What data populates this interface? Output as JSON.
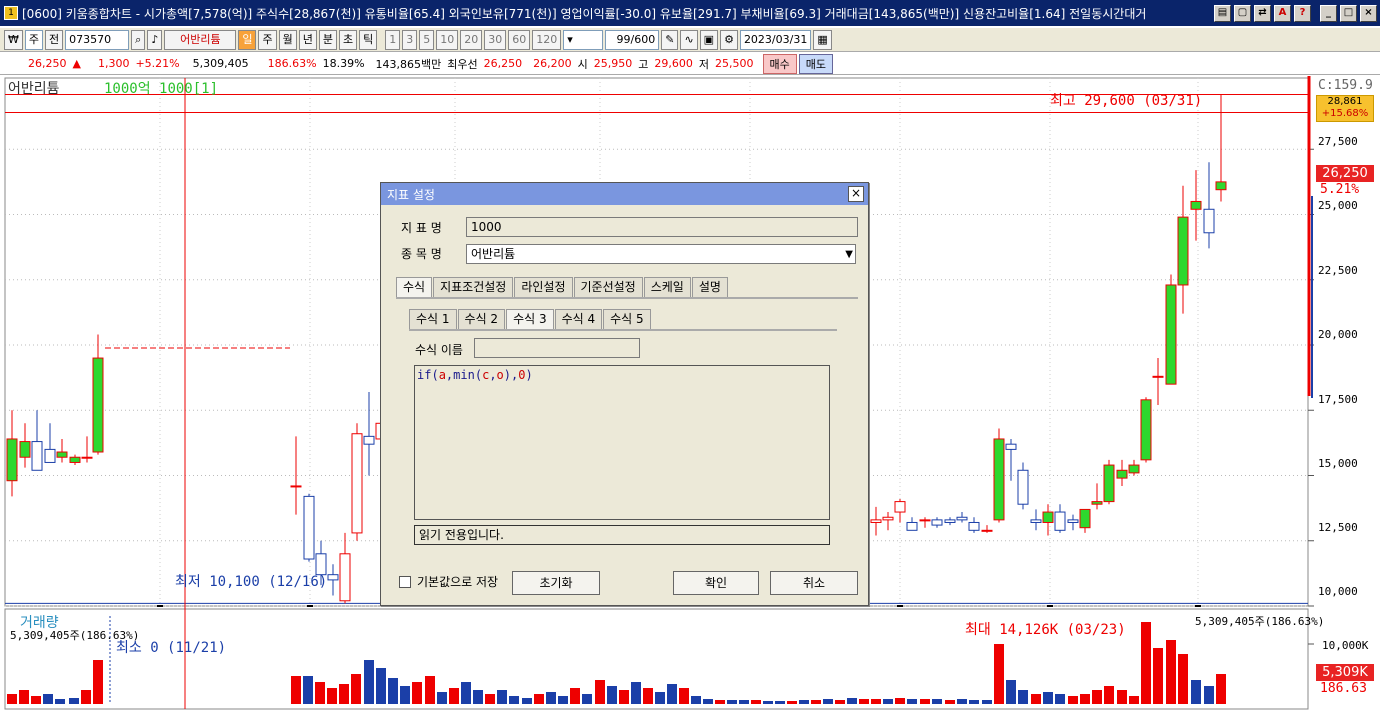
{
  "window": {
    "title": "[0600] 키움종합차트 - 시가총액[7,578(억)] 주식수[28,867(천)] 유통비율[65.4] 외국인보유[771(천)] 영업이익률[-30.0] 유보율[291.7] 부채비율[69.3] 거래대금[143,865(백만)] 신용잔고비율[1.64] 전일동시간대거",
    "app_icon": "1"
  },
  "toolbar": {
    "period": "주",
    "prev_label": "전",
    "code": "073570",
    "stock_name": "어반리튬",
    "intervals": [
      "일",
      "주",
      "월",
      "년",
      "분",
      "초",
      "틱"
    ],
    "active_interval": "일",
    "numbers": [
      "1",
      "3",
      "5",
      "10",
      "20",
      "30",
      "60",
      "120"
    ],
    "count": "99/600",
    "date": "2023/03/31"
  },
  "infobar": {
    "price": "26,250",
    "arrow": "▲",
    "change": "1,300",
    "change_pct": "+5.21%",
    "volume": "5,309,405",
    "vol_ratio": "186.63%",
    "turnover": "18.39%",
    "amount": "143,865백만",
    "quote_label": "최우선",
    "ask": "26,250",
    "bid": "26,200",
    "open_label": "시",
    "open": "25,950",
    "high_label": "고",
    "high": "29,600",
    "low_label": "저",
    "low": "25,500",
    "buy": "매수",
    "sell": "매도"
  },
  "chart": {
    "legend_name": "어반리튬",
    "legend_indicator": "1000억  1000[1]",
    "max_label": "최고 29,600 (03/31)",
    "min_label": "최저 10,100 (12/16)",
    "right_top": "C:159.9",
    "current_price_box": "28,861",
    "current_pct_box": "+15.68%",
    "last_price": "26,250",
    "last_pct": "5.21%",
    "y_ticks": [
      "27,500",
      "25,000",
      "22,500",
      "20,000",
      "17,500",
      "15,000",
      "12,500",
      "10,000"
    ],
    "volume_title": "거래량",
    "volume_value": "5,309,405주(186.63%)",
    "volume_value_right": "5,309,405주(186.63%)",
    "vol_min_label": "최소 0 (11/21)",
    "vol_max_label": "최대 14,126K (03/23)",
    "vol_ticks": [
      "10,000K"
    ],
    "vol_last": "5,309K",
    "vol_pct": "186.63"
  },
  "chart_data": {
    "type": "candlestick",
    "title": "어반리튬",
    "y_range": [
      10000,
      30000
    ],
    "max": {
      "value": 29600,
      "date": "03/31"
    },
    "min": {
      "value": 10100,
      "date": "12/16"
    },
    "last": 26250,
    "volume_max": {
      "value": 14126000,
      "date": "03/23"
    },
    "volume_last": 5309405
  },
  "dialog": {
    "title": "지표 설정",
    "name_label": "지 표 명",
    "name_value": "1000",
    "stock_label": "종 목 명",
    "stock_value": "어반리튬",
    "tabs": [
      "수식",
      "지표조건설정",
      "라인설정",
      "기준선설정",
      "스케일",
      "설명"
    ],
    "subtabs": [
      "수식 1",
      "수식 2",
      "수식 3",
      "수식 4",
      "수식 5"
    ],
    "formula_name_label": "수식 이름",
    "formula_name_value": "",
    "formula": "if(a,min(c,o),0)",
    "readonly_text": "읽기 전용입니다.",
    "default_save_label": "기본값으로 저장",
    "reset_label": "초기화",
    "ok_label": "확인",
    "cancel_label": "취소"
  }
}
